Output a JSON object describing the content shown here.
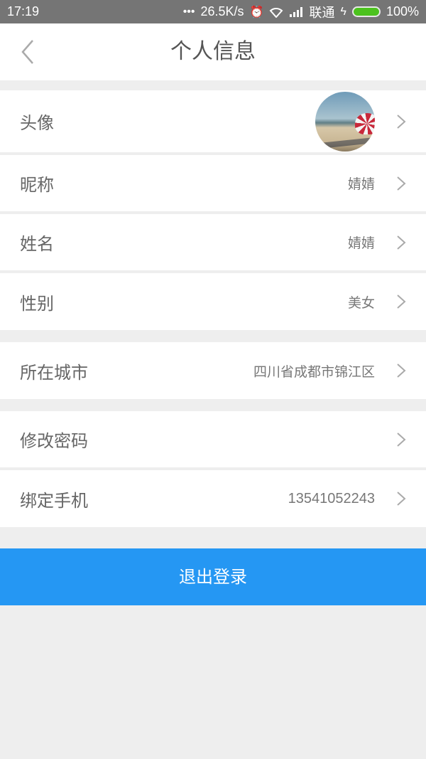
{
  "status_bar": {
    "time": "17:19",
    "network_speed": "26.5K/s",
    "carrier": "联通",
    "battery": "100%",
    "battery_color": "#4cc21e",
    "icons": [
      "dots-icon",
      "alarm-icon",
      "wifi-icon",
      "signal-icon",
      "charging-icon",
      "battery-icon"
    ]
  },
  "header": {
    "title": "个人信息",
    "back_icon": "chevron-left-icon"
  },
  "profile": {
    "avatar": {
      "label": "头像",
      "image": "beach-parachute-photo"
    },
    "nickname": {
      "label": "昵称",
      "value": "婧婧"
    },
    "name": {
      "label": "姓名",
      "value": "婧婧"
    },
    "gender": {
      "label": "性别",
      "value": "美女"
    },
    "city": {
      "label": "所在城市",
      "value": "四川省成都市锦江区"
    },
    "password": {
      "label": "修改密码",
      "value": ""
    },
    "phone": {
      "label": "绑定手机",
      "value": "13541052243"
    }
  },
  "logout": {
    "label": "退出登录",
    "color": "#2597f3"
  }
}
